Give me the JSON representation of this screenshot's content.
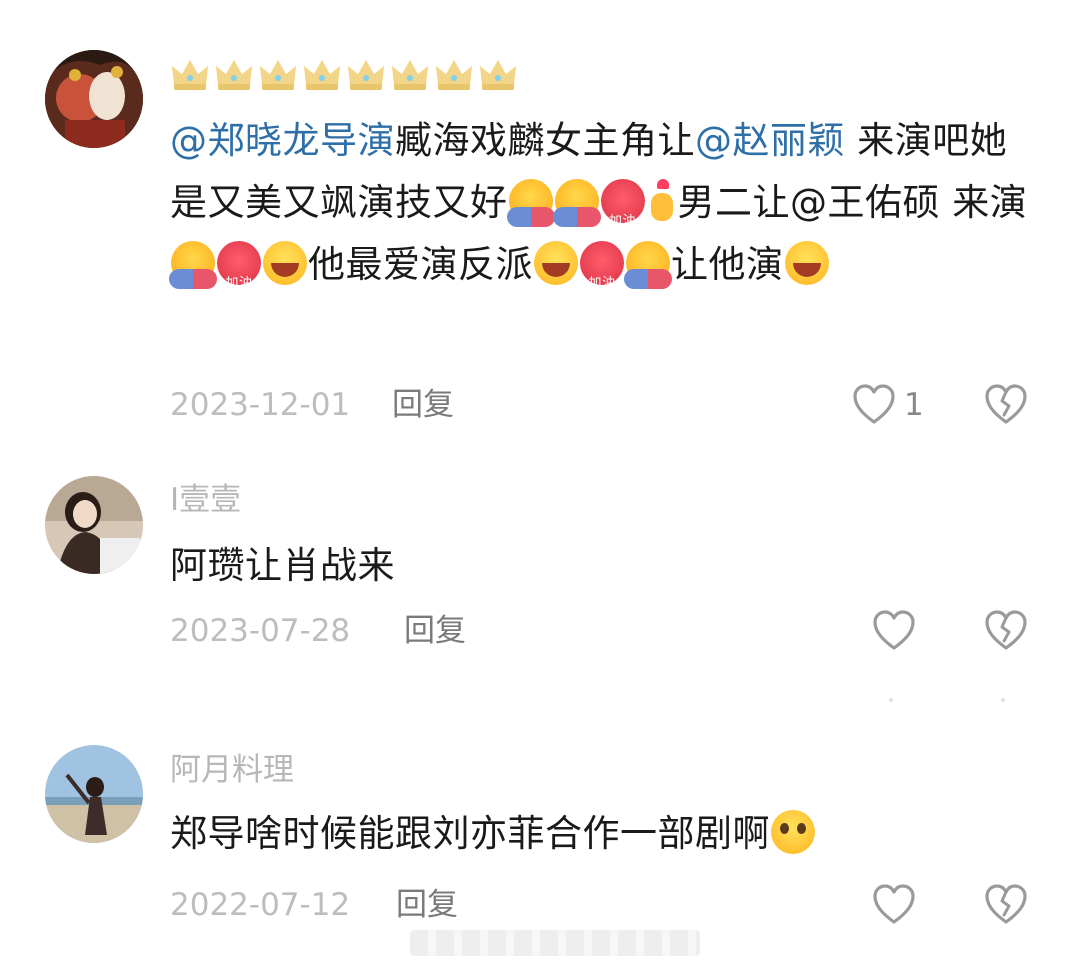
{
  "comments": [
    {
      "username": "",
      "crown_count": 8,
      "text_parts": [
        {
          "t": "@郑晓龙导演",
          "mention": true
        },
        {
          "t": "臧海戏麟女主角让",
          "mention": false
        },
        {
          "t": "@赵丽颖",
          "mention": true
        },
        {
          "t": " 来演吧她是又美又飒演技又好",
          "mention": false
        },
        {
          "emoji": "hug"
        },
        {
          "emoji": "hug"
        },
        {
          "emoji": "cheer"
        },
        {
          "emoji": "finger-heart"
        },
        {
          "t": "男二让@王佑硕 来演",
          "mention": false
        },
        {
          "emoji": "hug"
        },
        {
          "emoji": "cheer"
        },
        {
          "emoji": "laugh"
        },
        {
          "t": "他最爱演反派",
          "mention": false
        },
        {
          "emoji": "laugh"
        },
        {
          "emoji": "cheer"
        },
        {
          "emoji": "hug"
        },
        {
          "t": "让他演",
          "mention": false
        },
        {
          "emoji": "laugh"
        }
      ],
      "date": "2023-12-01",
      "reply_label": "回复",
      "like_count": "1"
    },
    {
      "username": "I壹壹",
      "text_parts": [
        {
          "t": "阿瓒让肖战来",
          "mention": false
        }
      ],
      "date": "2023-07-28",
      "reply_label": "回复",
      "like_count": ""
    },
    {
      "username": "阿月料理",
      "text_parts": [
        {
          "t": "郑导啥时候能跟刘亦菲合作一部剧啊",
          "mention": false
        },
        {
          "emoji": "pleading"
        }
      ],
      "date": "2022-07-12",
      "reply_label": "回复",
      "like_count": ""
    }
  ],
  "emoji_labels": {
    "cheer": "加油"
  },
  "icons": {
    "like": "heart-outline-icon",
    "dislike": "broken-heart-icon",
    "crown": "crown-icon"
  },
  "colors": {
    "mention": "#2f6fa8",
    "meta": "#bdbdbd",
    "username": "#b7b7b7"
  }
}
